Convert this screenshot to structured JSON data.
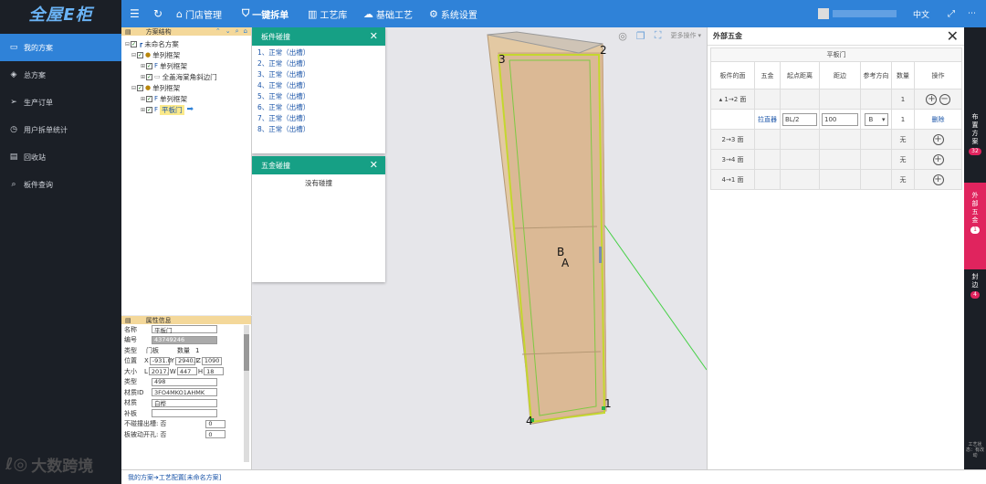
{
  "app": {
    "logo_text": "全屋E柜",
    "accent": "#2f82d8",
    "sidebar_bg": "#1b1f26"
  },
  "topnav": {
    "menu_icon": "hamburger-icon",
    "refresh_icon": "refresh-icon",
    "items": [
      {
        "label": "门店管理",
        "icon": "home-icon"
      },
      {
        "label": "一键拆单",
        "icon": "shield-icon"
      },
      {
        "label": "工艺库",
        "icon": "bars-icon"
      },
      {
        "label": "基础工艺",
        "icon": "cloud-icon"
      },
      {
        "label": "系统设置",
        "icon": "gear-icon"
      }
    ],
    "language": "中文",
    "fullscreen_icon": "fullscreen-icon"
  },
  "sidebar": {
    "items": [
      {
        "label": "我的方案",
        "icon": "screen-icon",
        "active": true
      },
      {
        "label": "总方案",
        "icon": "diamond-icon"
      },
      {
        "label": "生产订单",
        "icon": "send-icon"
      },
      {
        "label": "用户拆单统计",
        "icon": "clock-icon"
      },
      {
        "label": "回收站",
        "icon": "trash-icon"
      },
      {
        "label": "板件查询",
        "icon": "search-icon"
      }
    ]
  },
  "tree": {
    "title": "方案结构",
    "nodes": [
      {
        "label": "未命名方案",
        "depth": 0
      },
      {
        "label": "单列框架",
        "depth": 1
      },
      {
        "label": "单列框架",
        "depth": 2
      },
      {
        "label": "全盖海棠角斜边门",
        "depth": 2
      },
      {
        "label": "单列框架",
        "depth": 1
      },
      {
        "label": "单列框架",
        "depth": 2
      },
      {
        "label": "平板门",
        "depth": 2,
        "selected": true
      }
    ]
  },
  "props": {
    "title": "属性信息",
    "name_label": "名称",
    "name_value": "平板门",
    "id_label": "编号",
    "id_value": "43749246",
    "type_label": "类型",
    "type_value": "门板",
    "qty_label": "数量",
    "qty_value": "1",
    "pos_label": "位置",
    "pos_x_label": "X",
    "pos_x": "-931.0",
    "pos_y_label": "Y",
    "pos_y": "2940.1",
    "pos_z_label": "Z",
    "pos_z": "1090",
    "size_label": "大小",
    "size_l_label": "L",
    "size_l": "2017.",
    "size_w_label": "W",
    "size_w": "447",
    "size_h_label": "H",
    "size_h": "18",
    "kind_label": "类型",
    "kind_value": "498",
    "material_id_label": "材质ID",
    "material_id": "3FO4MKO1AHMK",
    "material_label": "材质",
    "material_value": "白桦",
    "edge_label": "补板",
    "edge_value": "",
    "no_slot_label": "不碰撞出槽:",
    "no_slot_value": "否",
    "no_slot_input": "0",
    "passive_label": "板被动开孔:",
    "passive_value": "否",
    "passive_input": "0"
  },
  "collision_dialog": {
    "title": "板件碰撞",
    "items": [
      "1、正常（出槽）",
      "2、正常（出槽）",
      "3、正常（出槽）",
      "4、正常（出槽）",
      "5、正常（出槽）",
      "6、正常（出槽）",
      "7、正常（出槽）",
      "8、正常（出槽）"
    ]
  },
  "hardware_collision_dialog": {
    "title": "五金碰撞",
    "message": "没有碰撞"
  },
  "viewport": {
    "more_ops": "更多操作",
    "labels": [
      "1",
      "2",
      "3",
      "4",
      "A",
      "B"
    ]
  },
  "hardware_panel": {
    "title": "外部五金",
    "subtitle": "平板门",
    "headers": [
      "板件的面",
      "五金",
      "起点距离",
      "距边",
      "参考方向",
      "数量",
      "操作"
    ],
    "rows": [
      {
        "face": "1→2 面",
        "qty": "1",
        "ops": "add-remove"
      },
      {
        "face": "",
        "hardware": "拉直器",
        "start": "BL/2",
        "edge": "100",
        "dir": "B",
        "qty": "1",
        "op_label": "删除"
      },
      {
        "face": "2→3 面",
        "qty": "无",
        "ops": "add"
      },
      {
        "face": "3→4 面",
        "qty": "无",
        "ops": "add"
      },
      {
        "face": "4→1 面",
        "qty": "无",
        "ops": "add"
      }
    ]
  },
  "right_strip": [
    {
      "label": "布置方案",
      "badge": "32"
    },
    {
      "label": "外部五金",
      "badge": "1",
      "active": true
    },
    {
      "label": "封边",
      "badge": "4"
    },
    {
      "label": "工艺状态：有改动",
      "badge": ""
    }
  ],
  "breadcrumb": {
    "root": "我的方案",
    "sep": "➔",
    "current": "工艺配置[未命名方案]"
  },
  "watermark": "大数跨境"
}
